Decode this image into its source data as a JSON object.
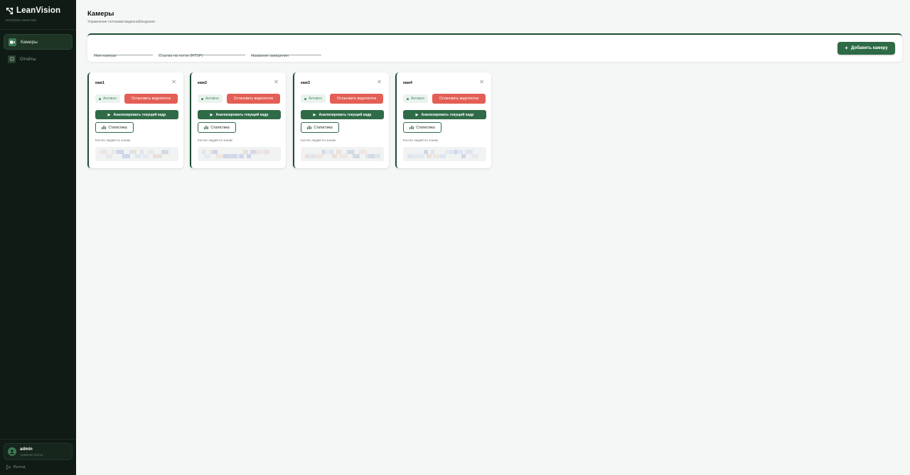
{
  "app": {
    "name": "LeanVision",
    "subtitle": "контроль качества"
  },
  "sidebar": {
    "items": [
      {
        "label": "Камеры",
        "icon": "video-camera-icon",
        "active": true
      },
      {
        "label": "Отчёты",
        "icon": "report-icon",
        "active": false
      }
    ],
    "user": {
      "name": "admin",
      "role": "Администратор"
    },
    "logout_label": "Выход"
  },
  "page": {
    "title": "Камеры",
    "subtitle": "Управление потоками видеонаблюдения"
  },
  "form": {
    "camera_name_placeholder": "Имя камеры",
    "stream_url_placeholder": "Ссылка на поток (RTSP)",
    "venue_placeholder": "Название заведения",
    "add_button_label": "Добавить камеру"
  },
  "cameras": [
    {
      "name": "кам1",
      "status": "Активно",
      "stop_label": "Остановить видеопоток",
      "analyze_label": "Анализировать текущий кадр",
      "stats_label": "Статистика",
      "history_label": "Кол-во людей по зонам"
    },
    {
      "name": "кам2",
      "status": "Активно",
      "stop_label": "Остановить видеопоток",
      "analyze_label": "Анализировать текущий кадр",
      "stats_label": "Статистика",
      "history_label": "Кол-во людей по зонам"
    },
    {
      "name": "кам3",
      "status": "Активно",
      "stop_label": "Остановить видеопоток",
      "analyze_label": "Анализировать текущий кадр",
      "stats_label": "Статистика",
      "history_label": "Кол-во людей по зонам"
    },
    {
      "name": "кам4",
      "status": "Активно",
      "stop_label": "Остановить видеопоток",
      "analyze_label": "Анализировать текущий кадр",
      "stats_label": "Статистика",
      "history_label": "Кол-во людей по зонам"
    }
  ],
  "colors": {
    "sidebar_bg": "#0f1b14",
    "accent": "#2d6a45",
    "danger": "#e35f55",
    "status": "#4b8d64"
  }
}
